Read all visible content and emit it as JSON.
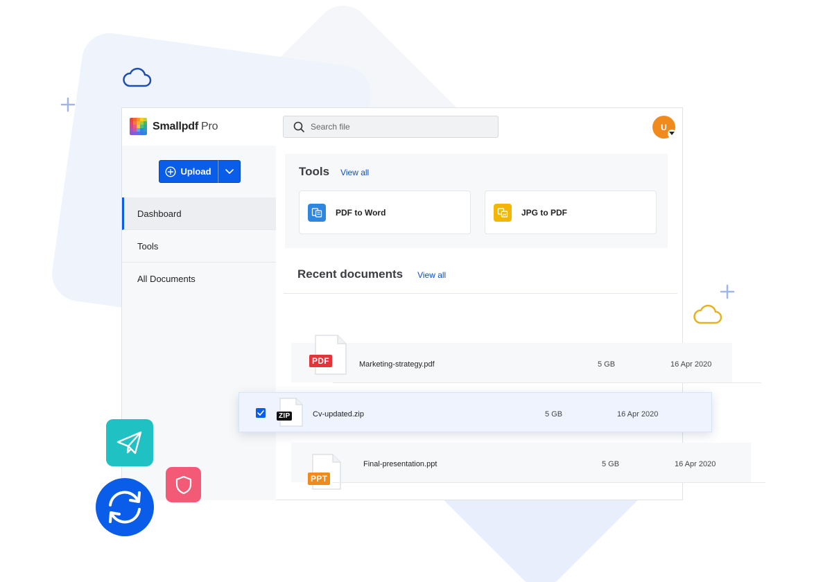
{
  "app": {
    "brand": "Smallpdf",
    "brand_suffix": "Pro",
    "logo_colors": [
      "#e8443a",
      "#f59b23",
      "#f7cf1d",
      "#3dbb5f",
      "#2e86de",
      "#8e57d6"
    ]
  },
  "search": {
    "placeholder": "Search file"
  },
  "user": {
    "initial": "U",
    "avatar_color": "#f08a1c"
  },
  "sidebar": {
    "upload_label": "Upload",
    "items": [
      {
        "label": "Dashboard",
        "active": true
      },
      {
        "label": "Tools",
        "active": false
      },
      {
        "label": "All Documents",
        "active": false
      }
    ]
  },
  "tools": {
    "title": "Tools",
    "view_all": "View all",
    "items": [
      {
        "label": "PDF to Word",
        "icon": "pdf-to-word-icon",
        "color": "#2e86de"
      },
      {
        "label": "JPG to PDF",
        "icon": "jpg-to-pdf-icon",
        "color": "#f2b705"
      }
    ]
  },
  "recent": {
    "title": "Recent documents",
    "view_all": "View all",
    "documents": [
      {
        "badge": "PDF",
        "badge_color": "#e3343a",
        "name": "Marketing-strategy.pdf",
        "size": "5 GB",
        "date": "16 Apr 2020",
        "selected": false
      },
      {
        "badge": "ZIP",
        "badge_color": "#111111",
        "name": "Cv-updated.zip",
        "size": "5 GB",
        "date": "16 Apr 2020",
        "selected": true
      },
      {
        "badge": "PPT",
        "badge_color": "#f08a1c",
        "name": "Final-presentation.ppt",
        "size": "5 GB",
        "date": "16 Apr 2020",
        "selected": false
      }
    ]
  },
  "colors": {
    "accent": "#0a5de8",
    "teal": "#1fc1c3",
    "pink": "#f25a75",
    "cloud_blue": "#1e4fb0",
    "cloud_yellow": "#e5b322"
  }
}
